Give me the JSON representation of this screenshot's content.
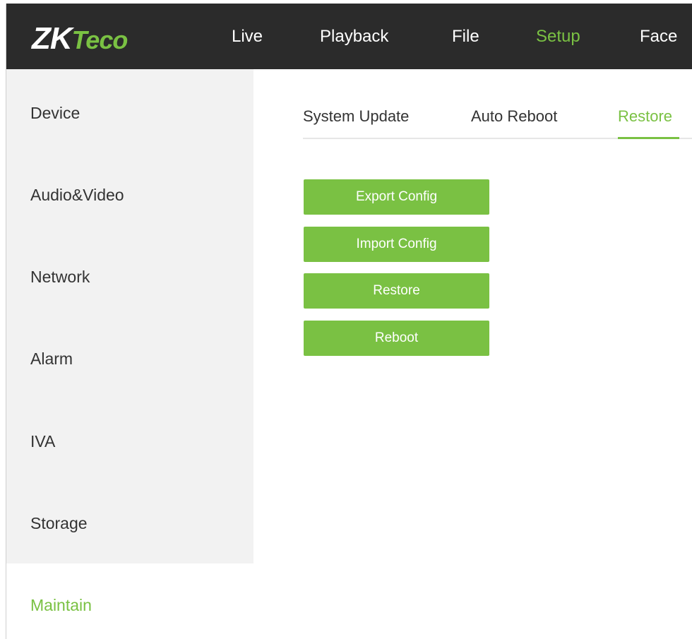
{
  "brand": {
    "logo_primary": "ZK",
    "logo_secondary": "Teco",
    "accent_color": "#7ac143",
    "header_color": "#2b2b2b"
  },
  "topnav": [
    {
      "label": "Live",
      "active": false
    },
    {
      "label": "Playback",
      "active": false
    },
    {
      "label": "File",
      "active": false
    },
    {
      "label": "Setup",
      "active": true
    },
    {
      "label": "Face",
      "active": false
    }
  ],
  "sidebar": {
    "items": [
      {
        "label": "Device",
        "active": false
      },
      {
        "label": "Audio&Video",
        "active": false
      },
      {
        "label": "Network",
        "active": false
      },
      {
        "label": "Alarm",
        "active": false
      },
      {
        "label": "IVA",
        "active": false
      },
      {
        "label": "Storage",
        "active": false
      },
      {
        "label": "Maintain",
        "active": true
      }
    ]
  },
  "tabs": [
    {
      "label": "System Update",
      "active": false
    },
    {
      "label": "Auto Reboot",
      "active": false
    },
    {
      "label": "Restore",
      "active": true
    }
  ],
  "actions": {
    "export_config": "Export Config",
    "import_config": "Import Config",
    "restore": "Restore",
    "reboot": "Reboot"
  }
}
